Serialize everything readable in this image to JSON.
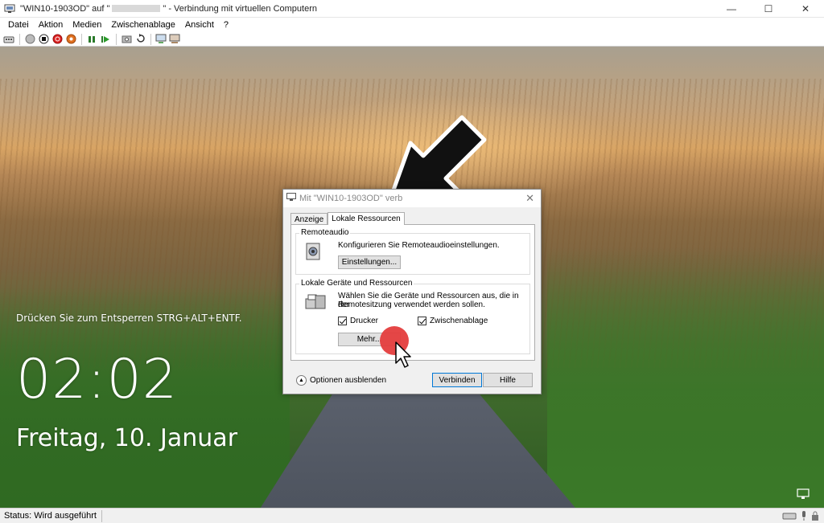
{
  "window": {
    "title_prefix": "\"WIN10-1903OD\" auf \"",
    "title_suffix": "\" - Verbindung mit virtuellen Computern",
    "minimize": "—",
    "maximize": "☐",
    "close": "✕"
  },
  "menu": [
    "Datei",
    "Aktion",
    "Medien",
    "Zwischenablage",
    "Ansicht",
    "?"
  ],
  "toolbar_icons": [
    "ctrl-alt-del-icon",
    "start-icon",
    "stop-icon",
    "shutdown-icon",
    "save-icon",
    "pause-icon",
    "resume-icon",
    "checkpoint-icon",
    "revert-icon",
    "enhanced-session-icon",
    "share-icon"
  ],
  "lockscreen": {
    "unlock_hint": "Drücken Sie zum Entsperren STRG+ALT+ENTF.",
    "time": "02:02",
    "date": "Freitag, 10. Januar"
  },
  "dialog": {
    "title": "Mit \"WIN10-1903OD\" verb",
    "close": "✕",
    "tabs": [
      {
        "label": "Anzeige",
        "active": false
      },
      {
        "label": "Lokale Ressourcen",
        "active": true
      }
    ],
    "remoteaudio": {
      "group_label": "Remoteaudio",
      "text": "Konfigurieren Sie Remoteaudioeinstellungen.",
      "button": "Einstellungen..."
    },
    "local": {
      "group_label": "Lokale Geräte und Ressourcen",
      "text_line1": "Wählen Sie die Geräte und Ressourcen aus, die in der",
      "text_line2": "Remotesitzung verwendet werden sollen.",
      "printer_label": "Drucker",
      "printer_checked": true,
      "clipboard_label": "Zwischenablage",
      "clipboard_checked": true,
      "more_button": "Mehr..."
    },
    "options_toggle": "Optionen ausblenden",
    "connect_button": "Verbinden",
    "help_button": "Hilfe"
  },
  "status": {
    "text": "Status: Wird ausgeführt"
  },
  "colors": {
    "accent": "#0078d7",
    "highlight_dot": "#e43d3d"
  }
}
